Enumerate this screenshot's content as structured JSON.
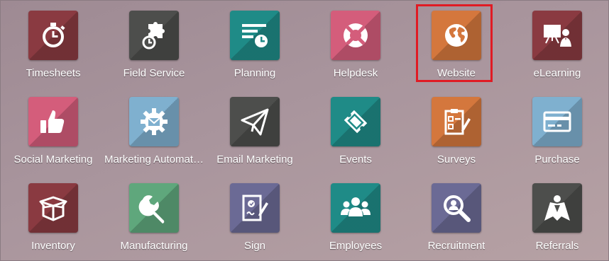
{
  "apps": [
    {
      "label": "Timesheets",
      "icon": "stopwatch-icon",
      "color": "#8a3a41"
    },
    {
      "label": "Field Service",
      "icon": "puzzle-clock-icon",
      "color": "#4d4e4c"
    },
    {
      "label": "Planning",
      "icon": "planning-lines-icon",
      "color": "#1f8b87"
    },
    {
      "label": "Helpdesk",
      "icon": "lifebuoy-icon",
      "color": "#d45d7b"
    },
    {
      "label": "Website",
      "icon": "globe-icon",
      "color": "#d4773d"
    },
    {
      "label": "eLearning",
      "icon": "teacher-board-icon",
      "color": "#8a3a41"
    },
    {
      "label": "Social Marketing",
      "icon": "thumbs-up-icon",
      "color": "#d45d7b"
    },
    {
      "label": "Marketing Automat…",
      "icon": "gear-envelope-icon",
      "color": "#7fb0cf"
    },
    {
      "label": "Email Marketing",
      "icon": "paper-plane-icon",
      "color": "#4d4e4c"
    },
    {
      "label": "Events",
      "icon": "ticket-icon",
      "color": "#1f8b87"
    },
    {
      "label": "Surveys",
      "icon": "clipboard-check-icon",
      "color": "#d4773d"
    },
    {
      "label": "Purchase",
      "icon": "credit-card-icon",
      "color": "#7fb0cf"
    },
    {
      "label": "Inventory",
      "icon": "box-icon",
      "color": "#8a3a41"
    },
    {
      "label": "Manufacturing",
      "icon": "wrench-icon",
      "color": "#5fa77c"
    },
    {
      "label": "Sign",
      "icon": "signed-document-icon",
      "color": "#6b6a95"
    },
    {
      "label": "Employees",
      "icon": "people-group-icon",
      "color": "#1f8b87"
    },
    {
      "label": "Recruitment",
      "icon": "magnifier-icon",
      "color": "#6b6a95"
    },
    {
      "label": "Referrals",
      "icon": "superhero-cape-icon",
      "color": "#4d4e4c"
    }
  ],
  "selected_app": "Website",
  "highlight_color": "#e01b24"
}
